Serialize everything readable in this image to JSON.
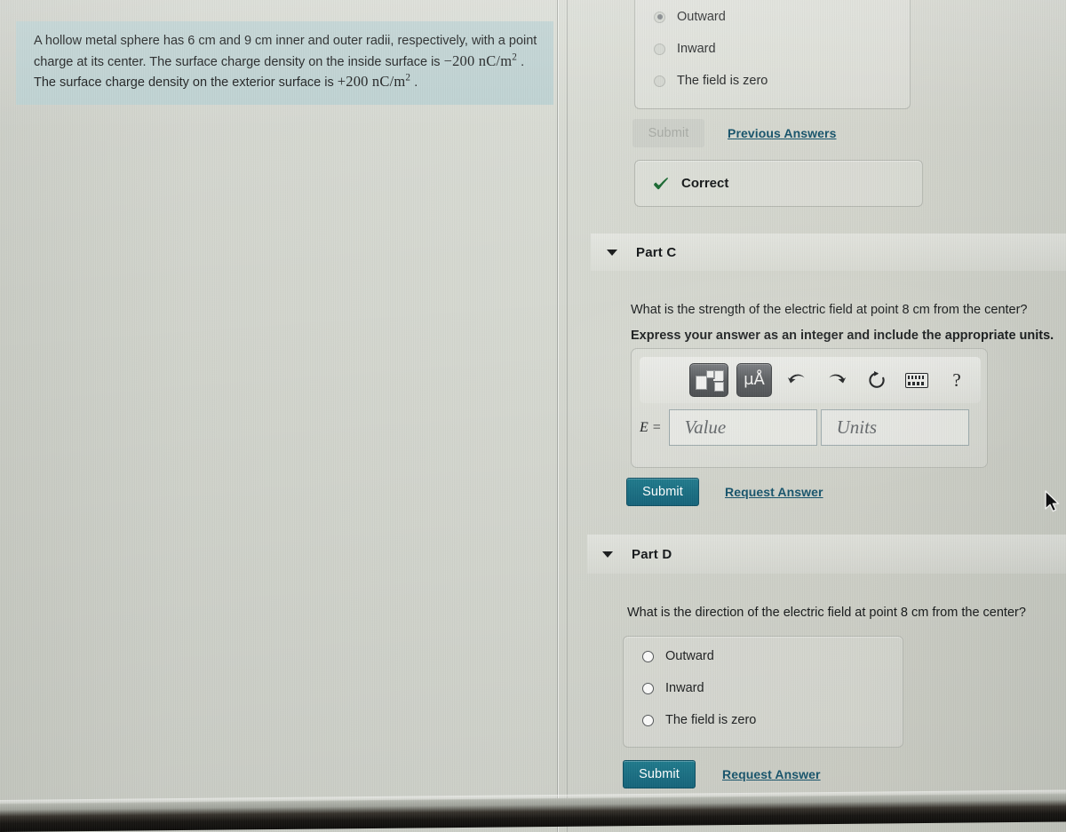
{
  "problem": {
    "text_1": "A hollow metal sphere has 6 cm and 9 cm inner and outer radii, respectively, with a point charge at its center. The surface charge density on the inside surface is",
    "value_inside": "−200 nC/m",
    "text_2": ". The surface charge density on the exterior surface is",
    "value_outside": "+200 nC/m",
    "text_3": "."
  },
  "part_b": {
    "options": [
      {
        "label": "Outward",
        "selected": true
      },
      {
        "label": "Inward",
        "selected": false
      },
      {
        "label": "The field is zero",
        "selected": false
      }
    ],
    "submit_label": "Submit",
    "submit_disabled": true,
    "previous_answers_label": "Previous Answers",
    "feedback_label": "Correct",
    "feedback_color": "#1b6b33"
  },
  "part_c": {
    "caret": "collapse-caret",
    "title": "Part C",
    "question": "What is the strength of the electric field at point 8 cm from the center?",
    "instruction": "Express your answer as an integer and include the appropriate units.",
    "toolbar": [
      {
        "name": "math-template-icon",
        "label": "template"
      },
      {
        "name": "units-icon",
        "label": "μÅ"
      },
      {
        "name": "undo-icon",
        "label": "undo"
      },
      {
        "name": "redo-icon",
        "label": "redo"
      },
      {
        "name": "reset-icon",
        "label": "reset"
      },
      {
        "name": "keyboard-icon",
        "label": "keyboard"
      },
      {
        "name": "help-icon",
        "label": "?"
      }
    ],
    "equation_label": "E =",
    "value_placeholder": "Value",
    "units_placeholder": "Units",
    "value_text": "",
    "units_text": "",
    "submit_label": "Submit",
    "request_answer_label": "Request Answer"
  },
  "part_d": {
    "caret": "collapse-caret",
    "title": "Part D",
    "question": "What is the direction of the electric field at point 8 cm from the center?",
    "options": [
      {
        "label": "Outward",
        "selected": false
      },
      {
        "label": "Inward",
        "selected": false
      },
      {
        "label": "The field is zero",
        "selected": false
      }
    ],
    "submit_label": "Submit",
    "request_answer_label": "Request Answer"
  },
  "colors": {
    "submit_button": "#1f7a8c",
    "link": "#16536b",
    "problem_background": "#bed2d2",
    "page_background": "#d4d7cf"
  }
}
